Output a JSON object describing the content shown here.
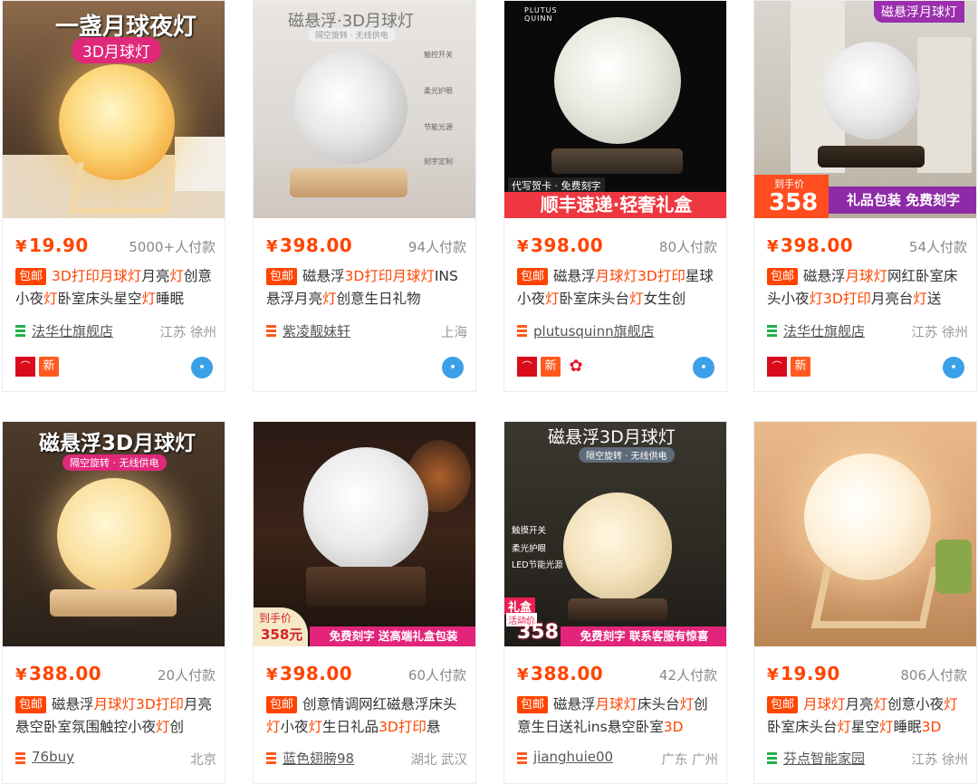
{
  "products": [
    {
      "overlay": [
        "一盏月球夜灯",
        "3D月球灯"
      ],
      "price": "19.90",
      "sales": "5000+人付款",
      "title_parts": [
        [
          "3D打印月球灯",
          1
        ],
        [
          "月亮",
          0
        ],
        [
          "灯",
          1
        ],
        [
          "创意小夜",
          0
        ],
        [
          "灯",
          1
        ],
        [
          "卧室床头星空",
          0
        ],
        [
          "灯",
          1
        ],
        [
          "睡眠",
          0
        ]
      ],
      "shop": "法华仕旗舰店",
      "location": "江苏 徐州",
      "badges": {
        "tmall": true,
        "xin": true,
        "flower": false,
        "wangwang": true
      }
    },
    {
      "overlay": [
        "磁悬浮·3D月球灯",
        "隔空旋转 · 无线供电",
        "触控开关",
        "柔光护眼",
        "节能光源",
        "刻字定制"
      ],
      "price": "398.00",
      "sales": "94人付款",
      "title_parts": [
        [
          "磁悬浮",
          0
        ],
        [
          "3D打印月球灯",
          1
        ],
        [
          "INS悬浮月亮",
          0
        ],
        [
          "灯",
          1
        ],
        [
          "创意生日礼物",
          0
        ]
      ],
      "shop": "紫凌靓妹轩",
      "location": "上海",
      "badges": {
        "tmall": false,
        "xin": false,
        "flower": false,
        "wangwang": true
      }
    },
    {
      "overlay": [
        "PLUTUS",
        "QUINN",
        "代写贺卡 · 免费刻字",
        "顺丰速递·轻奢礼盒"
      ],
      "price": "398.00",
      "sales": "80人付款",
      "title_parts": [
        [
          "磁悬浮",
          0
        ],
        [
          "月球灯3D打印",
          1
        ],
        [
          "星球小夜",
          0
        ],
        [
          "灯",
          1
        ],
        [
          "卧室床头台",
          0
        ],
        [
          "灯",
          1
        ],
        [
          "女生创",
          0
        ]
      ],
      "shop": "plutusquinn旗舰店",
      "location": "",
      "badges": {
        "tmall": true,
        "xin": true,
        "flower": true,
        "wangwang": true
      }
    },
    {
      "overlay": [
        "磁悬浮月球灯",
        "到手价",
        "358",
        "礼品包装 免费刻字"
      ],
      "price": "398.00",
      "sales": "54人付款",
      "title_parts": [
        [
          "磁悬浮",
          0
        ],
        [
          "月球灯",
          1
        ],
        [
          "网红卧室床头小夜",
          0
        ],
        [
          "灯3D打印",
          1
        ],
        [
          "月亮台",
          0
        ],
        [
          "灯",
          1
        ],
        [
          "送",
          0
        ]
      ],
      "shop": "法华仕旗舰店",
      "location": "江苏 徐州",
      "badges": {
        "tmall": true,
        "xin": true,
        "flower": false,
        "wangwang": true
      }
    },
    {
      "overlay": [
        "磁悬浮3D月球灯",
        "隔空旋转 · 无线供电"
      ],
      "price": "388.00",
      "sales": "20人付款",
      "title_parts": [
        [
          "磁悬浮",
          0
        ],
        [
          "月球灯3D打印",
          1
        ],
        [
          "月亮悬空卧室氛围触控小夜",
          0
        ],
        [
          "灯",
          1
        ],
        [
          "创",
          0
        ]
      ],
      "shop": "76buy",
      "location": "北京",
      "badges": {
        "tmall": false,
        "xin": false,
        "flower": false,
        "wangwang": false
      }
    },
    {
      "overlay": [
        "到手价",
        "358元",
        "免费刻字  送高端礼盒包装"
      ],
      "price": "398.00",
      "sales": "60人付款",
      "title_parts": [
        [
          "创意情调网红磁悬浮床头",
          0
        ],
        [
          "灯",
          1
        ],
        [
          "小夜",
          0
        ],
        [
          "灯",
          1
        ],
        [
          "生日礼品",
          0
        ],
        [
          "3D打印",
          1
        ],
        [
          "悬",
          0
        ]
      ],
      "shop": "蓝色翅膀98",
      "location": "湖北 武汉",
      "badges": {
        "tmall": false,
        "xin": false,
        "flower": false,
        "wangwang": false
      }
    },
    {
      "overlay": [
        "磁悬浮3D月球灯",
        "隔空旋转 · 无线供电",
        "触摸开关",
        "柔光护眼",
        "LED节能光源",
        "礼盒",
        "活动价",
        "358",
        "免费刻字  联系客服有惊喜"
      ],
      "price": "388.00",
      "sales": "42人付款",
      "title_parts": [
        [
          "磁悬浮",
          0
        ],
        [
          "月球灯",
          1
        ],
        [
          "床头台",
          0
        ],
        [
          "灯",
          1
        ],
        [
          "创意生日送礼ins悬空卧室",
          0
        ],
        [
          "3D",
          1
        ]
      ],
      "shop": "jianghuie00",
      "location": "广东 广州",
      "badges": {
        "tmall": false,
        "xin": false,
        "flower": false,
        "wangwang": false
      }
    },
    {
      "overlay": [],
      "price": "19.90",
      "sales": "806人付款",
      "title_parts": [
        [
          "月球灯",
          1
        ],
        [
          "月亮",
          0
        ],
        [
          "灯",
          1
        ],
        [
          "创意小夜",
          0
        ],
        [
          "灯",
          1
        ],
        [
          "卧室床头台",
          0
        ],
        [
          "灯",
          1
        ],
        [
          "星空",
          0
        ],
        [
          "灯",
          1
        ],
        [
          "睡眠",
          0
        ],
        [
          "3D",
          1
        ]
      ],
      "shop": "芬点智能家园",
      "location": "江苏 徐州",
      "badges": {
        "tmall": false,
        "xin": false,
        "flower": false,
        "wangwang": false
      }
    }
  ],
  "labels": {
    "currency": "¥",
    "free_shipping": "包邮",
    "tmall": "天猫",
    "xin": "新",
    "flower": "✿",
    "wangwang": "ww"
  },
  "colors": {
    "price": "#ff4400",
    "highlight": "#ff4400",
    "shop_icon_a": "#21b14b",
    "shop_icon_b": "#ff5a1f"
  }
}
